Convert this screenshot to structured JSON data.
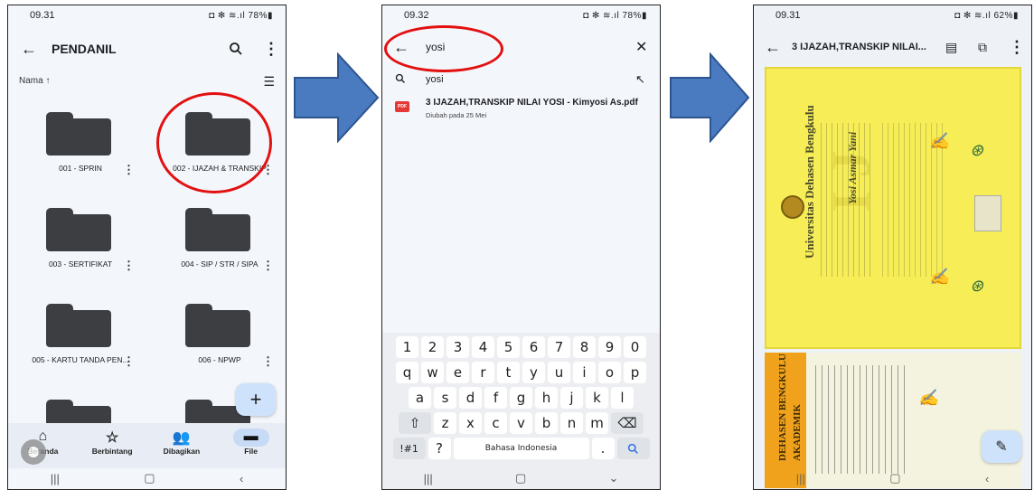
{
  "panel1": {
    "status": {
      "time": "09.31",
      "right": "◘ ✻ ≋.ıl 78%▮"
    },
    "appbar": {
      "title": "PENDANIL"
    },
    "sort_label": "Nama ↑",
    "folders": [
      {
        "name": "001 - SPRIN"
      },
      {
        "name": "002 - IJAZAH & TRANSKIP"
      },
      {
        "name": "003 - SERTIFIKAT"
      },
      {
        "name": "004 - SIP / STR / SIPA"
      },
      {
        "name": "005 - KARTU TANDA PEN..."
      },
      {
        "name": "006 - NPWP"
      }
    ],
    "bottom_nav": [
      {
        "label": "Beranda",
        "icon": "home-icon"
      },
      {
        "label": "Berbintang",
        "icon": "star-icon"
      },
      {
        "label": "Dibagikan",
        "icon": "shared-icon"
      },
      {
        "label": "File",
        "icon": "folder-icon"
      }
    ]
  },
  "panel2": {
    "status": {
      "time": "09.32",
      "right": "◘ ✻ ≋.ıl 78%▮"
    },
    "search": {
      "query": "yosi"
    },
    "suggestion": "yosi",
    "result": {
      "name": "3 IJAZAH,TRANSKIP NILAI YOSI - Kimyosi As.pdf",
      "subtitle": "Diubah pada 25 Mei",
      "badge": "PDF"
    },
    "keyboard": {
      "row1": [
        "1",
        "2",
        "3",
        "4",
        "5",
        "6",
        "7",
        "8",
        "9",
        "0"
      ],
      "row2": [
        "q",
        "w",
        "e",
        "r",
        "t",
        "y",
        "u",
        "i",
        "o",
        "p"
      ],
      "row3": [
        "a",
        "s",
        "d",
        "f",
        "g",
        "h",
        "j",
        "k",
        "l"
      ],
      "row4": [
        "z",
        "x",
        "c",
        "v",
        "b",
        "n",
        "m"
      ],
      "symbols_key": "!#1",
      "question_key": "?",
      "space_label": "Bahasa Indonesia",
      "period_key": "."
    }
  },
  "panel3": {
    "status": {
      "time": "09.31",
      "right": "◘ ✻ ≋.ıl 62%▮"
    },
    "title": "3 IJAZAH,TRANSKIP NILAI...",
    "doc1": {
      "university": "Universitas Dehasen Bengkulu",
      "name": "Yosi Asmar Yani"
    },
    "doc2": {
      "header": "DEHASEN BENGKULU",
      "sub": "AKADEMIK"
    }
  },
  "colors": {
    "highlight": "#e31010",
    "arrow": "#4a7ac0",
    "arrow_edge": "#2c5590"
  }
}
